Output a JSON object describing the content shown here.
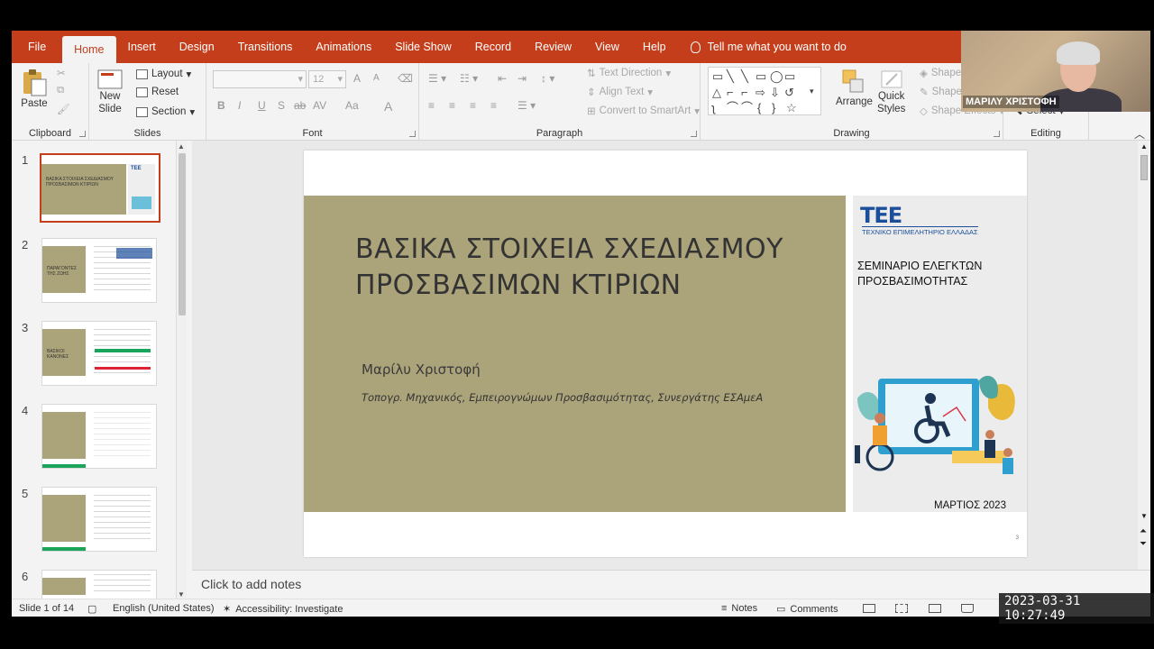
{
  "tabs": [
    {
      "label": "File",
      "active": false
    },
    {
      "label": "Home",
      "active": true
    },
    {
      "label": "Insert",
      "active": false
    },
    {
      "label": "Design",
      "active": false
    },
    {
      "label": "Transitions",
      "active": false
    },
    {
      "label": "Animations",
      "active": false
    },
    {
      "label": "Slide Show",
      "active": false
    },
    {
      "label": "Record",
      "active": false
    },
    {
      "label": "Review",
      "active": false
    },
    {
      "label": "View",
      "active": false
    },
    {
      "label": "Help",
      "active": false
    }
  ],
  "tell_me": "Tell me what you want to do",
  "ribbon": {
    "clipboard": {
      "label": "Clipboard",
      "paste": "Paste"
    },
    "slides": {
      "label": "Slides",
      "new_slide_1": "New",
      "new_slide_2": "Slide",
      "layout": "Layout",
      "reset": "Reset",
      "section": "Section"
    },
    "font": {
      "label": "Font",
      "size": "12",
      "bold": "B",
      "italic": "I",
      "underline": "U",
      "strike": "S",
      "shadow": "ab",
      "spacing": "AV",
      "case": "Aa",
      "color": "A",
      "grow": "A",
      "shrink": "A"
    },
    "paragraph": {
      "label": "Paragraph",
      "text_direction": "Text Direction",
      "align_text": "Align Text",
      "smartart": "Convert to SmartArt"
    },
    "drawing": {
      "label": "Drawing",
      "arrange": "Arrange",
      "quick_styles_1": "Quick",
      "quick_styles_2": "Styles",
      "shape_fill": "Shape Fi",
      "shape_outline": "Shape O",
      "shape_effects": "Shape Effects"
    },
    "editing": {
      "label": "Editing",
      "select": "Select"
    }
  },
  "webcam": {
    "name": "ΜΑΡΙΛΥ ΧΡΙΣΤΟΦΗ"
  },
  "thumbnails": [
    {
      "number": "1",
      "selected": true,
      "caption": "ΒΑΣΙΚΑ ΣΤΟΙΧΕΙΑ ΣΧΕΔΙΑΣΜΟΥ ΠΡΟΣΒΑΣΙΜΩΝ ΚΤΙΡΙΩΝ"
    },
    {
      "number": "2",
      "selected": false,
      "caption": "ΠΑΡΑΓΟΝΤΕΣ ΤΗΣ ΖΩΗΣ"
    },
    {
      "number": "3",
      "selected": false,
      "caption": "ΒΑΣΙΚΟΙ ΚΑΝΟΝΕΣ"
    },
    {
      "number": "4",
      "selected": false,
      "caption": ""
    },
    {
      "number": "5",
      "selected": false,
      "caption": ""
    },
    {
      "number": "6",
      "selected": false,
      "caption": ""
    }
  ],
  "slide": {
    "title_line1": "ΒΑΣΙΚΑ ΣΤΟΙΧΕΙΑ ΣΧΕΔΙΑΣΜΟΥ",
    "title_line2": "ΠΡΟΣΒΑΣΙΜΩΝ ΚΤΙΡΙΩΝ",
    "author": "Μαρίλυ Χριστοφή",
    "subtitle": "Τοπογρ. Μηχανικός, Εμπειρογνώμων Προσβασιμότητας, Συνεργάτης ΕΣΑμεΑ",
    "logo": "TEE",
    "logo_sub": "ΤΕΧΝΙΚΟ ΕΠΙΜΕΛΗΤΗΡΙΟ ΕΛΛΑΔΑΣ",
    "seminar_line1": "ΣΕΜΙΝΑΡΙΟ ΕΛΕΓΚΤΩΝ",
    "seminar_line2": "ΠΡΟΣΒΑΣΙΜΟΤΗΤΑΣ",
    "date": "ΜΑΡΤΙΟΣ 2023",
    "page_number": "3"
  },
  "notes_placeholder": "Click to add notes",
  "status": {
    "slide_of": "Slide 1 of 14",
    "language": "English (United States)",
    "accessibility": "Accessibility: Investigate",
    "notes": "Notes",
    "comments": "Comments"
  },
  "timestamp": "2023-03-31  10:27:49",
  "colors": {
    "accent": "#c43e1c",
    "olive": "#aba37a",
    "tee_blue": "#1b4f9b"
  }
}
